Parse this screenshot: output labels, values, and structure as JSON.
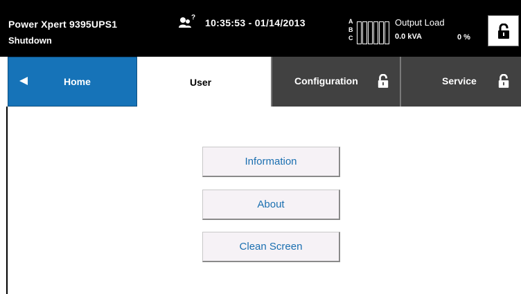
{
  "status_bar": {
    "device_name": "Power Xpert 9395UPS1",
    "system_state": "Shutdown",
    "user_icon": "user-level-icon",
    "user_level_badge": "?",
    "datetime": "10:35:53 - 01/14/2013",
    "phases": [
      "A",
      "B",
      "C"
    ],
    "load_bar_level": 0,
    "output_load_label": "Output Load",
    "output_load_kva": "0.0 kVA",
    "output_load_percent": "0 %",
    "lock_icon": "padlock-open-icon"
  },
  "tabs": {
    "home": {
      "label": "Home",
      "icon": "left-arrow-icon"
    },
    "user": {
      "label": "User"
    },
    "configuration": {
      "label": "Configuration",
      "icon": "padlock-open-icon"
    },
    "service": {
      "label": "Service",
      "icon": "padlock-open-icon"
    }
  },
  "menu": {
    "information_label": "Information",
    "about_label": "About",
    "clean_screen_label": "Clean Screen"
  },
  "colors": {
    "home_tab": "#1673b8",
    "locked_tab": "#414141",
    "status_bar": "#000000",
    "button_text": "#1a6fb0",
    "button_face": "#f6f2f6"
  }
}
